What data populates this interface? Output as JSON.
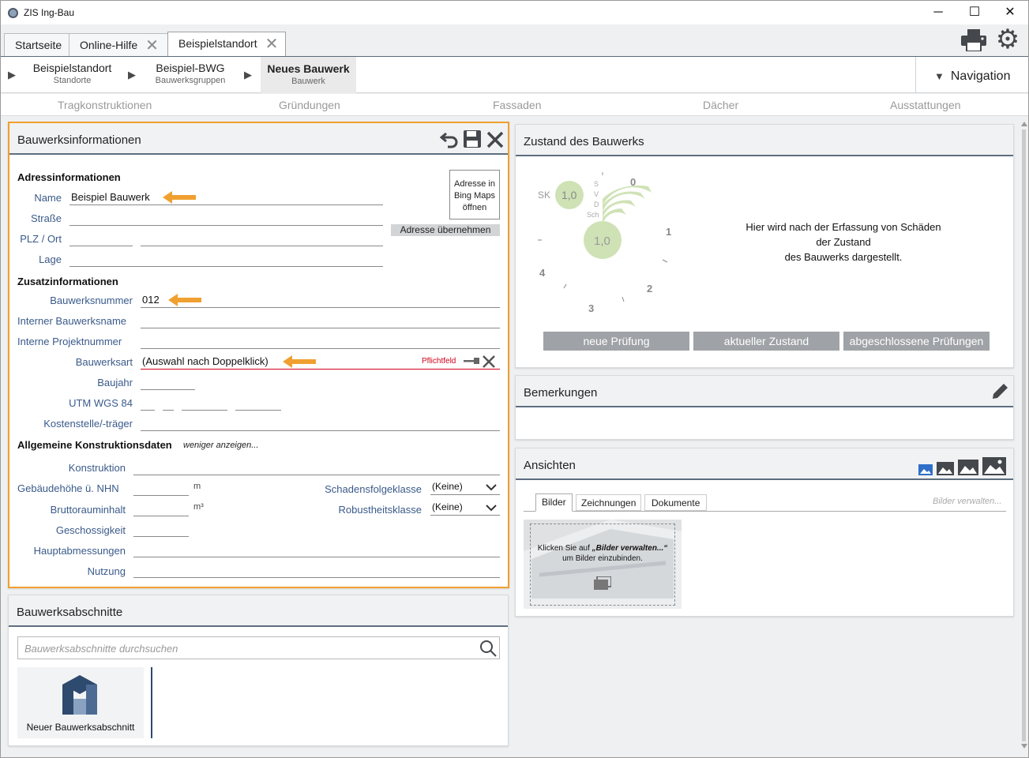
{
  "window": {
    "title": "ZIS Ing-Bau",
    "controls": {
      "minimize": "─",
      "maximize": "☐",
      "close": "✕"
    }
  },
  "tabs": [
    {
      "label": "Startseite"
    },
    {
      "label": "Online-Hilfe",
      "close": "✕"
    },
    {
      "label": "Beispielstandort",
      "close": "✕"
    }
  ],
  "breadcrumb": [
    {
      "title": "Beispielstandort",
      "sub": "Standorte"
    },
    {
      "title": "Beispiel-BWG",
      "sub": "Bauwerksgruppen"
    },
    {
      "title": "Neues Bauwerk",
      "sub": "Bauwerk"
    }
  ],
  "navigation": {
    "label": "Navigation",
    "icon": "▼"
  },
  "categories": [
    "Tragkonstruktionen",
    "Gründungen",
    "Fassaden",
    "Dächer",
    "Ausstattungen"
  ],
  "info": {
    "title": "Bauwerksinformationen",
    "address_heading": "Adressinformationen",
    "name_label": "Name",
    "name_value": "Beispiel Bauwerk",
    "street_label": "Straße",
    "plz_label": "PLZ / Ort",
    "lage_label": "Lage",
    "bing_button": "Adresse in Bing Maps öffnen",
    "adopt_button": "Adresse übernehmen",
    "zusatz_heading": "Zusatzinformationen",
    "nummer_label": "Bauwerksnummer",
    "nummer_value": "012",
    "interner_name_label": "Interner Bauwerksname",
    "projekt_label": "Interne Projektnummer",
    "art_label": "Bauwerksart",
    "art_value": "(Auswahl nach Doppelklick)",
    "pflicht": "Pflichtfeld",
    "baujahr_label": "Baujahr",
    "utm_label": "UTM WGS 84",
    "kosten_label": "Kostenstelle/-träger",
    "allg_heading": "Allgemeine Konstruktionsdaten",
    "weniger": "weniger anzeigen...",
    "konstruktion_label": "Konstruktion",
    "hoehe_label": "Gebäudehöhe ü. NHN",
    "hoehe_unit": "m",
    "brutto_label": "Bruttorauminhalt",
    "brutto_unit": "m³",
    "geschoss_label": "Geschossigkeit",
    "haupt_label": "Hauptabmessungen",
    "nutzung_label": "Nutzung",
    "schaden_label": "Schadensfolgeklasse",
    "schaden_value": "(Keine)",
    "robust_label": "Robustheitsklasse",
    "robust_value": "(Keine)"
  },
  "sections": {
    "title": "Bauwerksabschnitte",
    "search_placeholder": "Bauwerksabschnitte durchsuchen",
    "new_label": "Neuer Bauwerksabschnitt"
  },
  "zustand": {
    "title": "Zustand des Bauwerks",
    "sk_label": "SK",
    "sk_value": "1,0",
    "main_value": "1,0",
    "letters": [
      "S",
      "V",
      "D",
      "Sch"
    ],
    "ticks": [
      "0",
      "1",
      "2",
      "3",
      "4"
    ],
    "message_line1": "Hier wird nach der Erfassung von Schäden",
    "message_line2": "der Zustand",
    "message_line3": "des Bauwerks dargestellt.",
    "buttons": [
      "neue Prüfung",
      "aktueller Zustand",
      "abgeschlossene Prüfungen"
    ]
  },
  "bemerkungen": {
    "title": "Bemerkungen"
  },
  "ansichten": {
    "title": "Ansichten",
    "tabs": [
      "Bilder",
      "Zeichnungen",
      "Dokumente"
    ],
    "manage": "Bilder verwalten...",
    "hint_pre": "Klicken Sie auf ",
    "hint_em": "„Bilder verwalten...“",
    "hint_post": "um Bilder einzubinden."
  },
  "colors": {
    "accent": "#f0a030",
    "header_line": "#5e6e80",
    "gauge": "#cfe2b5",
    "required": "#d0021b"
  }
}
